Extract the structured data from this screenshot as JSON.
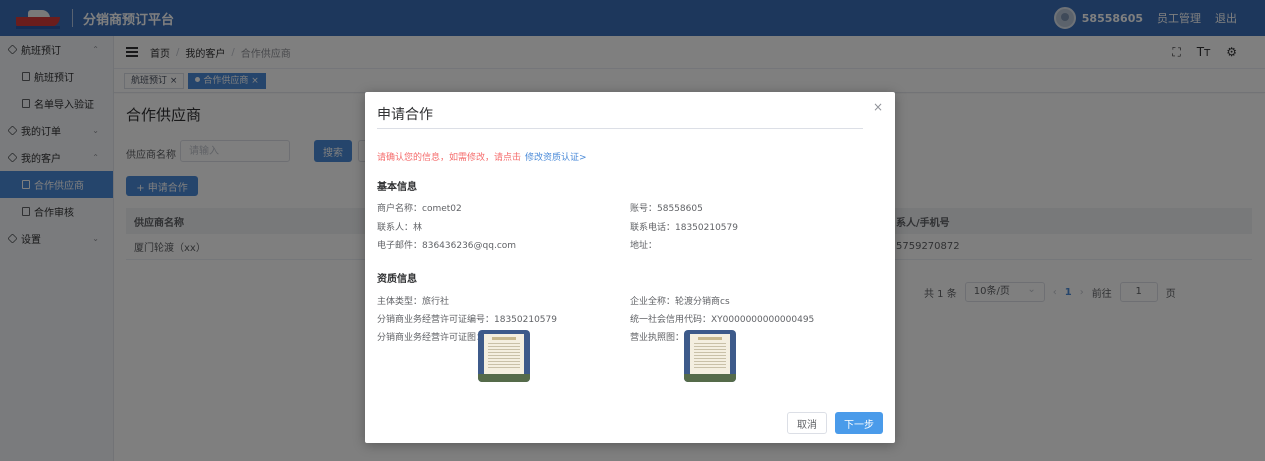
{
  "header": {
    "brand": "分销商预订平台",
    "account": "58558605",
    "staff_manage": "员工管理",
    "logout": "退出"
  },
  "sidebar": {
    "groups": [
      {
        "label": "航班预订",
        "arrow": "⌃",
        "items": [
          "航班预订",
          "名单导入验证"
        ]
      },
      {
        "label": "我的订单",
        "arrow": "⌄"
      },
      {
        "label": "我的客户",
        "arrow": "⌃",
        "items": [
          "合作供应商",
          "合作审核"
        ]
      },
      {
        "label": "设置",
        "arrow": "⌄"
      }
    ]
  },
  "navbar": {
    "crumbs": [
      "首页",
      "我的客户",
      "合作供应商"
    ],
    "crumb_sep": "/",
    "icons": [
      "fullscreen-icon",
      "font-size-icon",
      "settings-icon"
    ]
  },
  "tags": [
    {
      "label": "航班预订 ×"
    },
    {
      "label": "合作供应商 ×"
    }
  ],
  "page": {
    "title": "合作供应商",
    "filter_label": "供应商名称",
    "filter_placeholder": "请输入",
    "search_label": "搜索",
    "apply_label": "+ 申请合作",
    "table": {
      "headers": [
        "供应商名称",
        "系人/手机号"
      ],
      "rows": [
        [
          "厦门轮渡（xx）",
          "5759270872"
        ]
      ]
    },
    "pager": {
      "total": "共 1 条",
      "page_size": "10条/页",
      "prev": "‹",
      "current": "1",
      "next": "›",
      "goto": "前往",
      "goto_value": "1",
      "page_unit": "页"
    }
  },
  "dialog": {
    "title": "申请合作",
    "close": "×",
    "notice": "请确认您的信息，如需修改，请点击",
    "notice_link": "修改资质认证>",
    "basic_title": "基本信息",
    "merchant": "商户名称：comet02",
    "account_no": "账号：58558605",
    "contact": "联系人：林",
    "phone": "联系电话：18350210579",
    "email": "电子邮件：836436236@qq.com",
    "address": "地址：",
    "qual_title": "资质信息",
    "subject_type": "主体类型：旅行社",
    "company_name": "企业全称：轮渡分销商cs",
    "license_no": "分销商业务经营许可证编号：18350210579",
    "credit_code": "统一社会信用代码：XY0000000000000495",
    "license_img_label": "分销商业务经营许可证图：",
    "business_img_label": "营业执照图：",
    "cancel": "取消",
    "next": "下一步"
  }
}
